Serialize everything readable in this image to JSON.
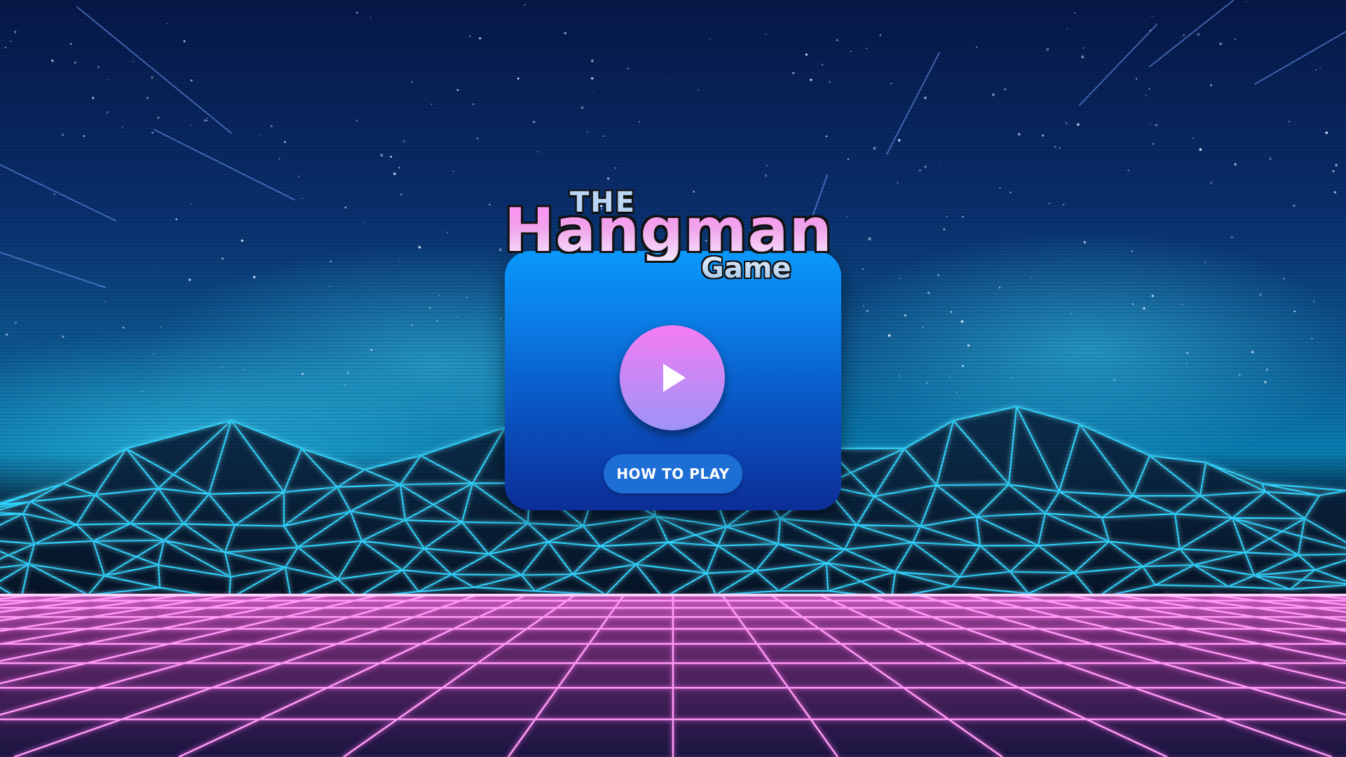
{
  "title": {
    "the": "THE",
    "main": "Hangman",
    "sub": "Game"
  },
  "menu": {
    "play_icon": "play-icon",
    "how_to_play_label": "HOW TO PLAY"
  },
  "colors": {
    "panel_top": "#0a98fb",
    "panel_bottom": "#0c2d97",
    "play_top": "#f47bf2",
    "play_bottom": "#9c93f7",
    "how_to_play_bg": "#1d6fd6",
    "mountain_wire": "#2fd3ff",
    "grid_wire": "#ff8cf7"
  }
}
